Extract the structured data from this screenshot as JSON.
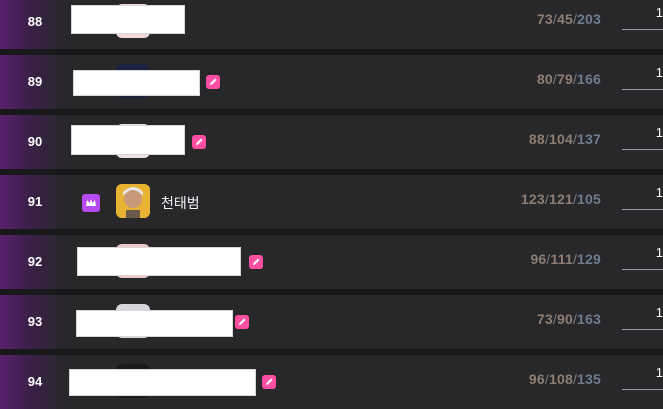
{
  "rows": [
    {
      "rank": "88",
      "name_tail": "",
      "k": "73",
      "d": "45",
      "a": "203",
      "score": "1"
    },
    {
      "rank": "89",
      "name_tail": "",
      "k": "80",
      "d": "79",
      "a": "166",
      "score": "1"
    },
    {
      "rank": "90",
      "name_tail": "",
      "k": "88",
      "d": "104",
      "a": "137",
      "score": "1"
    },
    {
      "rank": "91",
      "name": "천태범",
      "k": "123",
      "d": "121",
      "a": "105",
      "score": "1"
    },
    {
      "rank": "92",
      "name_tail": "",
      "k": "96",
      "d": "111",
      "a": "129",
      "score": "1"
    },
    {
      "rank": "93",
      "name_tail": "",
      "k": "73",
      "d": "90",
      "a": "163",
      "score": "1"
    },
    {
      "rank": "94",
      "name_tail": "",
      "k": "96",
      "d": "108",
      "a": "135",
      "score": "1"
    }
  ],
  "stat_separator": "/",
  "colors": {
    "row_bg": "#28282b",
    "rank_gradient": "#5a2170",
    "edit_badge": "#ff4fa3",
    "crown_badge": "#b84bf0",
    "kills": "#8e7d72",
    "assists": "#6f7d8e"
  },
  "icons": {
    "edit_badge": "pencil-icon",
    "crown_badge": "crown-icon",
    "avatar": "player-avatar"
  }
}
